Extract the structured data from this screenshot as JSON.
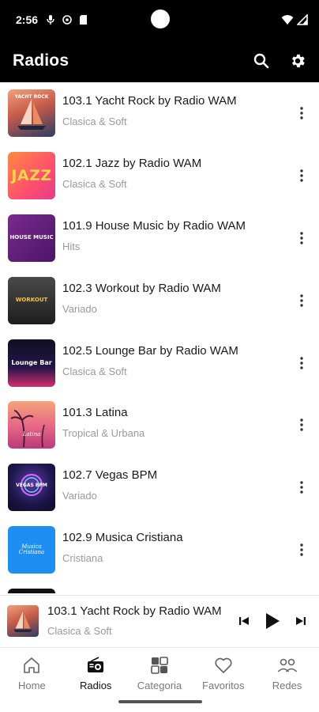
{
  "status_bar": {
    "time": "2:56"
  },
  "app_bar": {
    "title": "Radios",
    "actions": [
      {
        "name": "search-icon"
      },
      {
        "name": "settings-gear-icon"
      }
    ]
  },
  "stations": [
    {
      "title": "103.1 Yacht Rock by Radio WAM",
      "genre": "Clasica & Soft",
      "art_text": "YACHT ROCK",
      "art_color": "#b34a3a"
    },
    {
      "title": "102.1 Jazz by Radio WAM",
      "genre": "Clasica & Soft",
      "art_text": "JAZZ",
      "art_color": "#ff6b4a"
    },
    {
      "title": "101.9 House Music by Radio WAM",
      "genre": "Hits",
      "art_text": "HOUSE MUSIC",
      "art_color": "#6a1b7a"
    },
    {
      "title": "102.3 Workout by Radio WAM",
      "genre": "Variado",
      "art_text": "WORKOUT",
      "art_color": "#333333"
    },
    {
      "title": "102.5 Lounge Bar by Radio WAM",
      "genre": "Clasica & Soft",
      "art_text": "Lounge Bar",
      "art_color": "#1a1a3a"
    },
    {
      "title": "101.3 Latina",
      "genre": "Tropical & Urbana",
      "art_text": "Latina",
      "art_color": "#e0607a"
    },
    {
      "title": "102.7 Vegas BPM",
      "genre": "Variado",
      "art_text": "VEGAS BPM",
      "art_color": "#1a1a4a"
    },
    {
      "title": "102.9 Musica Cristiana",
      "genre": "Cristiana",
      "art_text": "Musica Cristiana",
      "art_color": "#1e8cf0"
    }
  ],
  "mini_player": {
    "title": "103.1 Yacht Rock by Radio WAM",
    "genre": "Clasica & Soft"
  },
  "bottom_nav": [
    {
      "label": "Home",
      "icon": "home-icon",
      "active": false
    },
    {
      "label": "Radios",
      "icon": "radio-icon",
      "active": true
    },
    {
      "label": "Categoria",
      "icon": "category-grid-icon",
      "active": false
    },
    {
      "label": "Favoritos",
      "icon": "heart-icon",
      "active": false
    },
    {
      "label": "Redes",
      "icon": "people-icon",
      "active": false
    }
  ]
}
